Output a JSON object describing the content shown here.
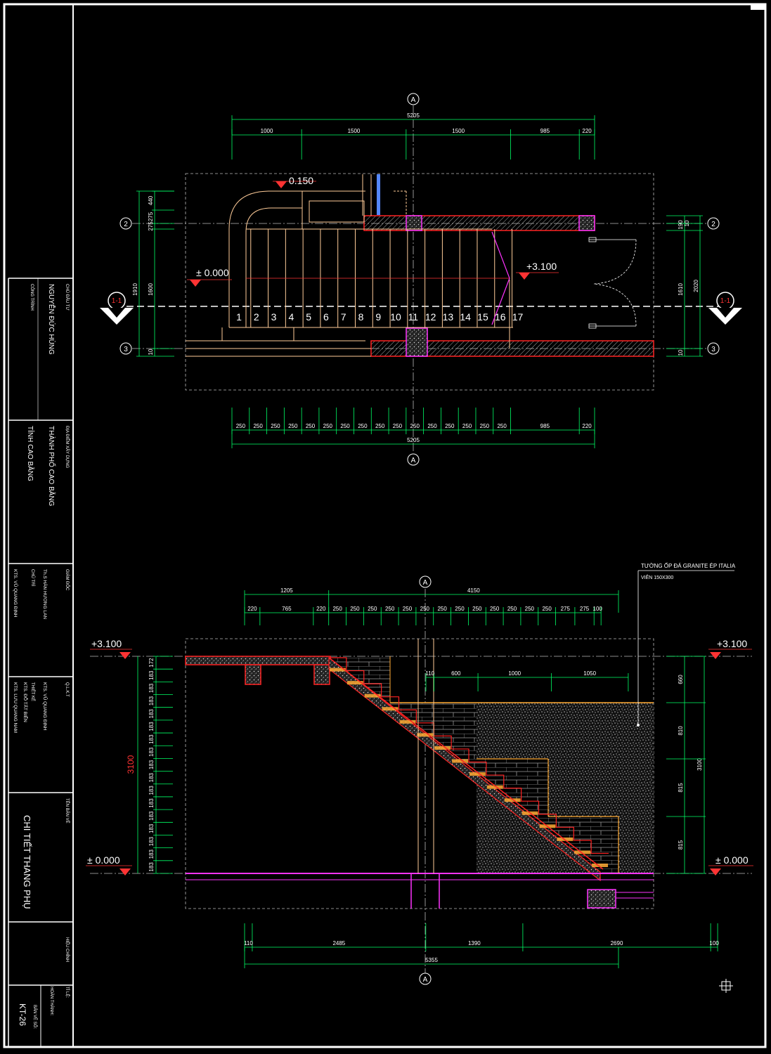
{
  "title_block": {
    "chu_dau_tu_label": "CHỦ ĐẦU TƯ",
    "chu_dau_tu": "NGUYỄN ĐỨC HÙNG",
    "cong_trinh_label": "CÔNG TRÌNH",
    "dia_diem_label": "ĐỊA ĐIỂM XÂY DỰNG",
    "dia_diem_1": "THÀNH PHỐ CAO BẰNG",
    "dia_diem_2": "TỈNH CAO BẰNG",
    "giam_doc_label": "GIÁM ĐỐC",
    "giam_doc": "Th.S HÀN HƯƠNG LAN",
    "chu_tri_label": "CHỦ TRÌ",
    "chu_tri": "KTS. VŨ QUANG ĐỊNH",
    "qlkt_label": "Q.L.K.T",
    "qlkt": "KTS. VŨ QUANG ĐỊNH",
    "thiet_ke_label": "THIẾT KẾ",
    "thiet_ke_1": "KTS. ĐỖ TẤT BIỂN",
    "thiet_ke_2": "KTS. LƯU QUANG NAM",
    "ten_ban_ve_label": "TÊN BẢN VẼ",
    "ten_ban_ve": "CHI TIẾT THANG PHỤ",
    "hieu_chinh_label": "HIỆU CHỈNH",
    "ti_le_label": "TỈ LỆ:",
    "hoan_thanh_label": "HOÀN THÀNH:",
    "ban_ve_so_label": "BẢN VẼ SỐ:",
    "ban_ve_so": "KT-26"
  },
  "plan": {
    "axis_A": "A",
    "axis_2": "2",
    "axis_3": "3",
    "section_mark": "1-1",
    "total_top": "5205",
    "total_bottom": "5205",
    "top_dims": [
      "1000",
      "1500",
      "1500",
      "985",
      "220"
    ],
    "bottom_dims": [
      "250",
      "250",
      "250",
      "250",
      "250",
      "250",
      "250",
      "250",
      "250",
      "250",
      "250",
      "250",
      "250",
      "250",
      "250",
      "250",
      "985",
      "220"
    ],
    "left_dims": [
      "440",
      "275",
      "275",
      "1910",
      "1600",
      "10"
    ],
    "right_dims": [
      "10",
      "190",
      "1610",
      "2020",
      "10"
    ],
    "level_top": "0.150",
    "level_start": "± 0.000",
    "level_end": "+3.100",
    "step_numbers": [
      "1",
      "2",
      "3",
      "4",
      "5",
      "6",
      "7",
      "8",
      "9",
      "10",
      "11",
      "12",
      "13",
      "14",
      "15",
      "16",
      "17"
    ]
  },
  "section": {
    "axis_A": "A",
    "note_1": "TƯỜNG ỐP ĐÁ GRANITE ÉP ITALIA",
    "note_2": "VIÊN 150X300",
    "top_total_1": "1205",
    "top_total_2": "4150",
    "top_dims": [
      "220",
      "765",
      "220",
      "250",
      "250",
      "250",
      "250",
      "250",
      "250",
      "250",
      "250",
      "250",
      "250",
      "250",
      "250",
      "250",
      "275",
      "275",
      "100"
    ],
    "inner_dims": [
      "110",
      "600",
      "1000",
      "1050"
    ],
    "bottom_dims": [
      "110",
      "2485",
      "1390",
      "2690",
      "100"
    ],
    "bottom_total": "5355",
    "level_left_top": "+3.100",
    "level_right_top": "+3.100",
    "level_left_bottom": "± 0.000",
    "level_right_bottom": "± 0.000",
    "height_left": "3100",
    "height_right": "3100",
    "riser_dims": [
      "172",
      "183",
      "183",
      "183",
      "183",
      "183",
      "183",
      "183",
      "183",
      "183",
      "183",
      "183",
      "183",
      "183",
      "183",
      "183",
      "183"
    ],
    "right_dims": [
      "660",
      "810",
      "815",
      "815"
    ]
  },
  "colors": {
    "background": "#000000",
    "border": "#ffffff",
    "dim_line": "#00ff66",
    "stair_line": "#ffcc99",
    "hatch_red": "#ff2222",
    "magenta": "#ff33ff",
    "axis_line": "#bbbbbb",
    "cyan": "#66aaff"
  }
}
